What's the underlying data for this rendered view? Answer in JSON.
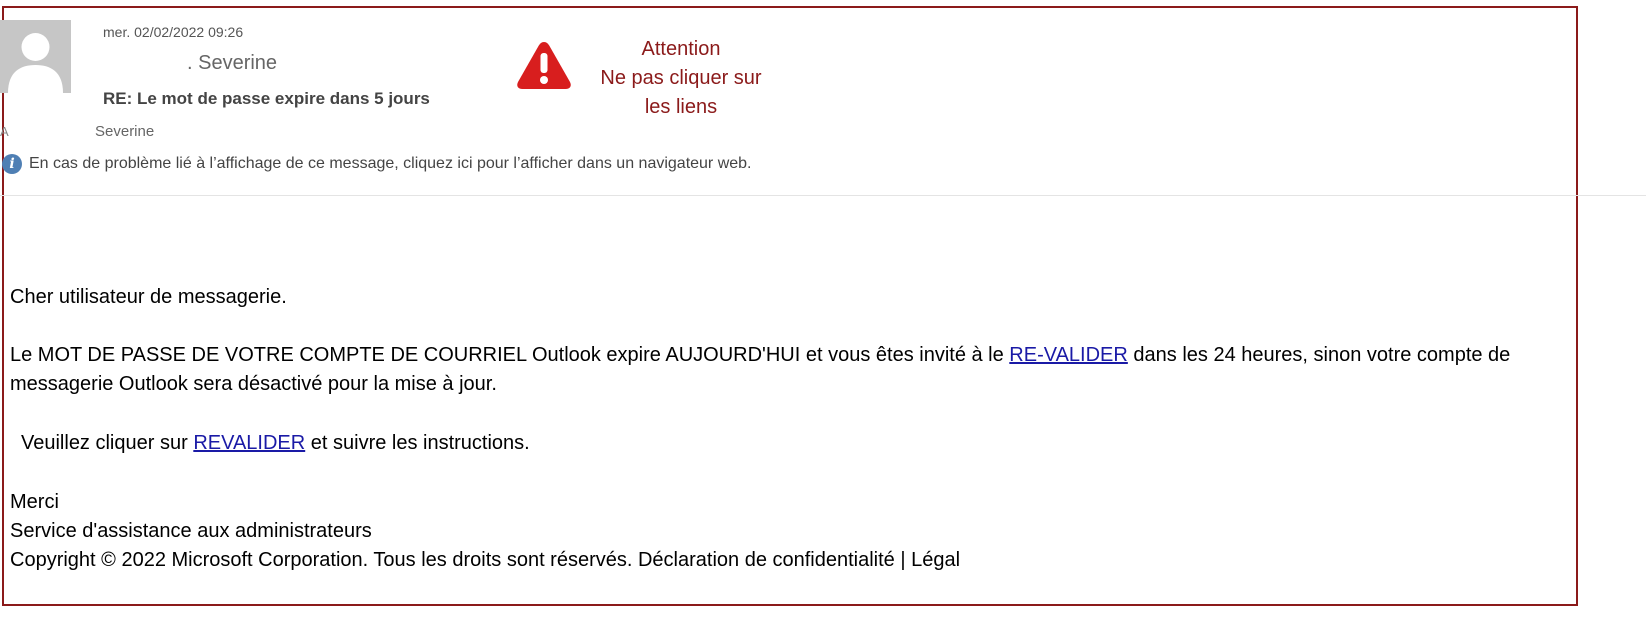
{
  "header": {
    "date": "mer. 02/02/2022 09:26",
    "sender": ". Severine",
    "subject": "RE: Le mot de passe expire dans 5 jours",
    "to_label": "A",
    "to_value": "Severine",
    "info_text": "En cas de problème lié à l’affichage de ce message, cliquez ici pour l’afficher dans un navigateur web."
  },
  "warning": {
    "line1": "Attention",
    "line2": "Ne pas cliquer sur",
    "line3": "les liens",
    "color": "#8b1a1a"
  },
  "message": {
    "greeting": "Cher utilisateur de messagerie.",
    "para1_before": "Le MOT DE PASSE DE VOTRE COMPTE DE COURRIEL Outlook expire AUJOURD'HUI et vous êtes invité à le ",
    "para1_link": "RE-VALIDER",
    "para1_after": " dans les 24 heures, sinon votre compte de",
    "para1_line2": "messagerie Outlook sera désactivé pour la mise à jour.",
    "para2_before": "Veuillez cliquer sur ",
    "para2_link": "REVALIDER",
    "para2_after": " et suivre les instructions.",
    "closing": "Merci",
    "signature": "Service d'assistance aux administrateurs",
    "copyright": "Copyright © 2022 Microsoft Corporation. Tous les droits sont réservés. Déclaration de confidentialité | Légal"
  },
  "icons": {
    "avatar": "person-silhouette-icon",
    "info": "info-icon",
    "warning": "warning-triangle-icon"
  },
  "colors": {
    "frame": "#8b1a1a",
    "link": "#1a1aa6",
    "info_icon": "#4f7fb4"
  }
}
